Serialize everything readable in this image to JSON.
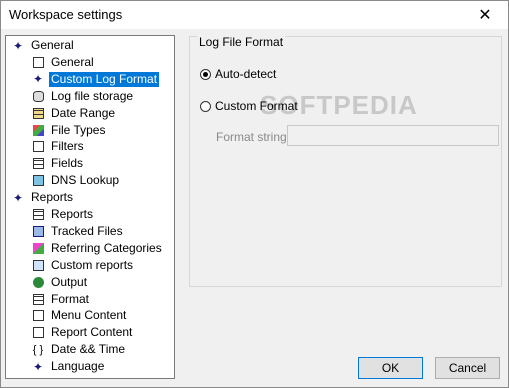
{
  "window": {
    "title": "Workspace settings",
    "close_glyph": "✕"
  },
  "tree": [
    {
      "label": "General",
      "icon": "star-icon",
      "glyph": "✦",
      "indent": 0
    },
    {
      "label": "General",
      "icon": "settings-doc-icon",
      "glyph": "",
      "indent": 1
    },
    {
      "label": "Custom Log Format",
      "icon": "star-icon",
      "glyph": "✦",
      "indent": 1,
      "selected": true
    },
    {
      "label": "Log file storage",
      "icon": "database-icon",
      "glyph": "",
      "indent": 1
    },
    {
      "label": "Date Range",
      "icon": "calendar-grid-icon",
      "glyph": "",
      "indent": 1
    },
    {
      "label": "File Types",
      "icon": "file-types-icon",
      "glyph": "",
      "indent": 1
    },
    {
      "label": "Filters",
      "icon": "filter-icon",
      "glyph": "",
      "indent": 1
    },
    {
      "label": "Fields",
      "icon": "fields-icon",
      "glyph": "",
      "indent": 1
    },
    {
      "label": "DNS Lookup",
      "icon": "computer-icon",
      "glyph": "",
      "indent": 1
    },
    {
      "label": "Reports",
      "icon": "star-icon",
      "glyph": "✦",
      "indent": 0
    },
    {
      "label": "Reports",
      "icon": "report-table-icon",
      "glyph": "",
      "indent": 1
    },
    {
      "label": "Tracked Files",
      "icon": "tracked-files-icon",
      "glyph": "",
      "indent": 1
    },
    {
      "label": "Referring Categories",
      "icon": "categories-icon",
      "glyph": "",
      "indent": 1
    },
    {
      "label": "Custom reports",
      "icon": "custom-reports-icon",
      "glyph": "",
      "indent": 1
    },
    {
      "label": "Output",
      "icon": "output-icon",
      "glyph": "",
      "indent": 1
    },
    {
      "label": "Format",
      "icon": "format-icon",
      "glyph": "",
      "indent": 1
    },
    {
      "label": "Menu Content",
      "icon": "document-icon",
      "glyph": "",
      "indent": 1
    },
    {
      "label": "Report Content",
      "icon": "document-icon",
      "glyph": "",
      "indent": 1
    },
    {
      "label": "Date && Time",
      "icon": "braces-icon",
      "glyph": "{ }",
      "indent": 1
    },
    {
      "label": "Language",
      "icon": "star-icon",
      "glyph": "✦",
      "indent": 1
    }
  ],
  "panel": {
    "group_label": "Log File Format",
    "auto_detect": "Auto-detect",
    "custom_format": "Custom Format",
    "format_string_label": "Format string:",
    "format_string_value": "",
    "watermark": "SOFTPEDIA"
  },
  "buttons": {
    "ok": "OK",
    "cancel": "Cancel"
  },
  "colors": {
    "selection": "#0078d7"
  }
}
